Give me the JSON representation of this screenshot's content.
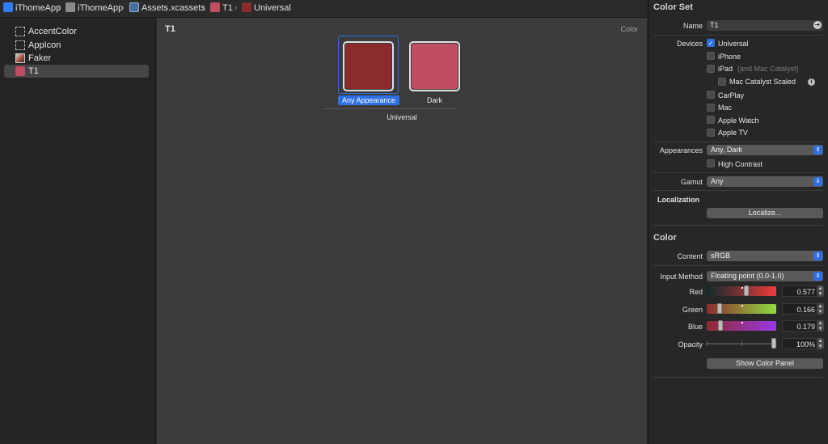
{
  "breadcrumb": [
    "iThomeApp",
    "iThomeApp",
    "Assets.xcassets",
    "T1",
    "Universal"
  ],
  "sidebar": {
    "items": [
      {
        "label": "AccentColor",
        "icon": "color-set-icon"
      },
      {
        "label": "AppIcon",
        "icon": "appicon-set-icon"
      },
      {
        "label": "Faker",
        "icon": "image-set-icon"
      },
      {
        "label": "T1",
        "icon": "color-swatch-icon"
      }
    ]
  },
  "canvas": {
    "title": "T1",
    "type_label": "Color",
    "swatches": [
      {
        "label": "Any Appearance",
        "color": "#8c2b2e"
      },
      {
        "label": "Dark",
        "color": "#c14e60"
      }
    ],
    "group_label": "Universal"
  },
  "inspector": {
    "color_set_title": "Color Set",
    "name_label": "Name",
    "name_value": "T1",
    "devices_label": "Devices",
    "devices": [
      "Universal",
      "iPhone",
      "iPad",
      "Mac Catalyst Scaled",
      "CarPlay",
      "Mac",
      "Apple Watch",
      "Apple TV"
    ],
    "ipad_note": "(and Mac Catalyst)",
    "appearances_label": "Appearances",
    "appearances_value": "Any, Dark",
    "high_contrast": "High Contrast",
    "gamut_label": "Gamut",
    "gamut_value": "Any",
    "localization_title": "Localization",
    "localize_button": "Localize...",
    "color_title": "Color",
    "content_label": "Content",
    "content_value": "sRGB",
    "input_method_label": "Input Method",
    "input_method_value": "Floating point (0.0-1.0)",
    "red_label": "Red",
    "red_value": "0.577",
    "green_label": "Green",
    "green_value": "0.166",
    "blue_label": "Blue",
    "blue_value": "0.179",
    "opacity_label": "Opacity",
    "opacity_value": "100%",
    "show_panel_button": "Show Color Panel"
  },
  "colors": {
    "accent": "#2f6fe4",
    "t1_any": "#8c2b2e",
    "t1_dark": "#c14e60"
  }
}
